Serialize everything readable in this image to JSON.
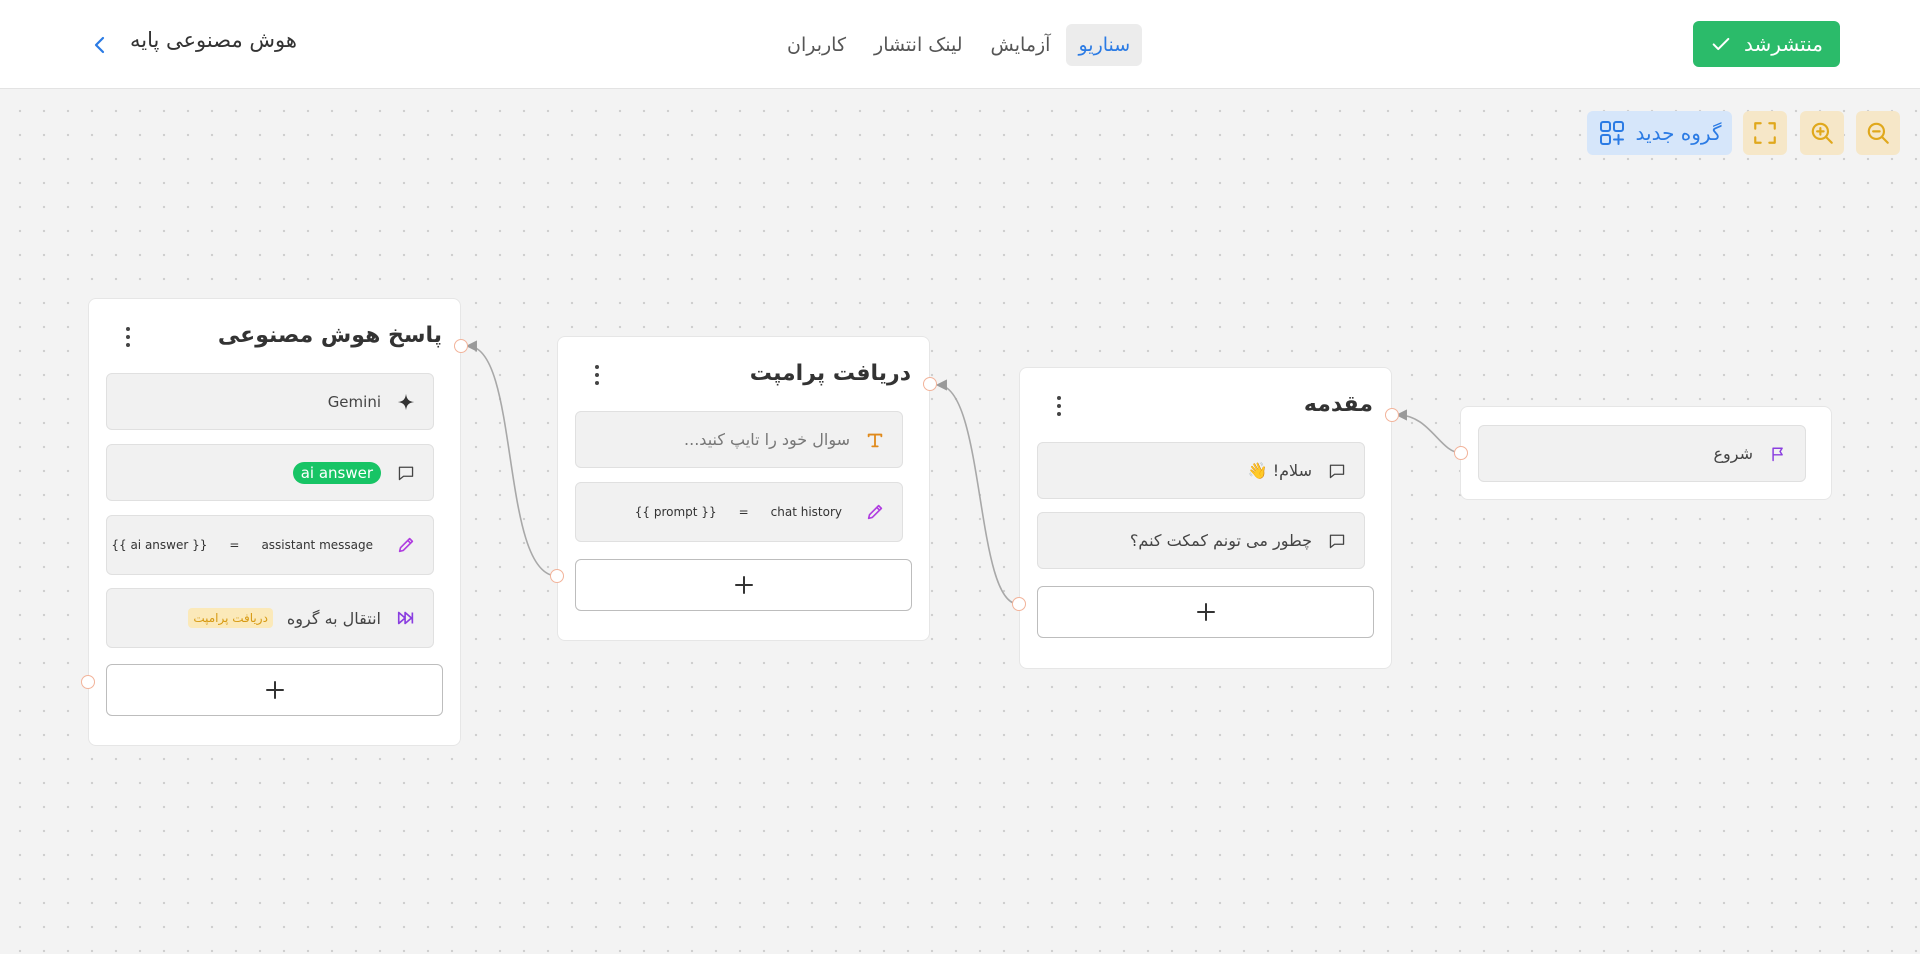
{
  "header": {
    "publish_label": "منتشرشد",
    "bot_title": "هوش مصنوعی پایه",
    "tabs": [
      {
        "label": "سناریو",
        "active": true
      },
      {
        "label": "آزمایش",
        "active": false
      },
      {
        "label": "لینک انتشار",
        "active": false
      },
      {
        "label": "کاربران",
        "active": false
      }
    ]
  },
  "toolbar": {
    "new_group_label": "گروه جدید",
    "zoom_out_icon": "zoom-out-icon",
    "zoom_in_icon": "zoom-in-icon",
    "fit_icon": "fullscreen-icon"
  },
  "colors": {
    "accent_blue": "#2b7be4",
    "publish_green": "#2bbb6a",
    "badge_green": "#17c465",
    "tool_yellow": "#f6e7c8",
    "port_border": "#f2b39a"
  },
  "groups": {
    "start": {
      "blocks": [
        {
          "icon": "flag-icon",
          "text": "شروع"
        }
      ]
    },
    "intro": {
      "title": "مقدمه",
      "blocks": [
        {
          "icon": "message-icon",
          "text": "سلام! 👋"
        },
        {
          "icon": "message-icon",
          "text": "چطور می تونم کمکت کنم؟"
        }
      ]
    },
    "prompt": {
      "title": "دریافت پرامپت",
      "blocks": [
        {
          "icon": "text-input-icon",
          "placeholder": "سوال خود را تایپ کنید..."
        },
        {
          "icon": "pencil-icon",
          "variable": "chat history",
          "equals": "=",
          "value": "{{ prompt }}"
        }
      ]
    },
    "ai": {
      "title": "پاسخ هوش مصنوعی",
      "blocks": [
        {
          "icon": "sparkle-icon",
          "text": "Gemini"
        },
        {
          "icon": "message-icon",
          "badge": "ai answer"
        },
        {
          "icon": "pencil-icon",
          "variable": "assistant message",
          "equals": "=",
          "value": "{{ ai answer }}"
        },
        {
          "icon": "jump-icon",
          "text": "انتقال به گروه",
          "badge": "دریافت پرامپت"
        }
      ]
    }
  }
}
